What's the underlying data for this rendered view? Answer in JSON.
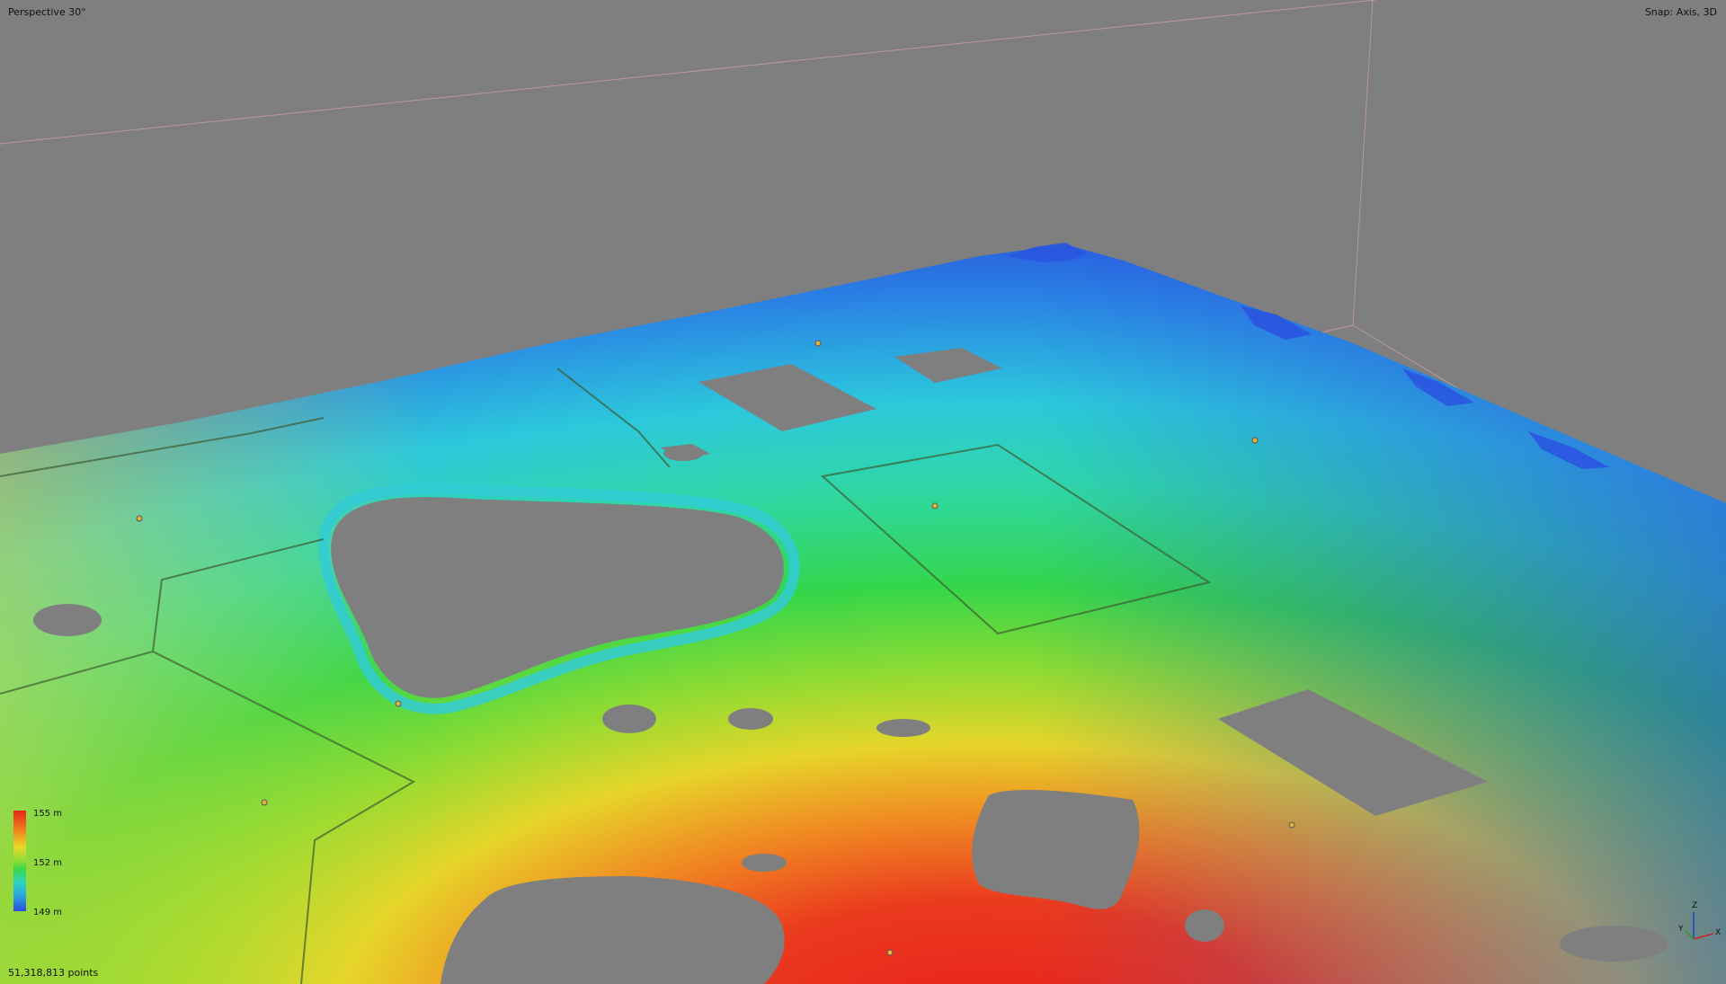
{
  "viewport": {
    "view_mode": "Perspective 30°",
    "snap_mode": "Snap: Axis, 3D",
    "point_count": "51,318,813 points"
  },
  "legend": {
    "max_label": "155 m",
    "mid_label": "152 m",
    "min_label": "149 m",
    "colors": [
      "#e8221a",
      "#f07a1c",
      "#e9d828",
      "#3ad64a",
      "#2ed3c0",
      "#2aa8e0",
      "#2a4fe0"
    ]
  },
  "axis_gizmo": {
    "z_label": "Z",
    "y_label": "Y",
    "x_label": "X",
    "colors": {
      "x": "#d02020",
      "y": "#20a020",
      "z": "#2040d0"
    }
  },
  "scene": {
    "background": "#7f7f7f",
    "bounding_box_color": "#c9a0a0"
  }
}
